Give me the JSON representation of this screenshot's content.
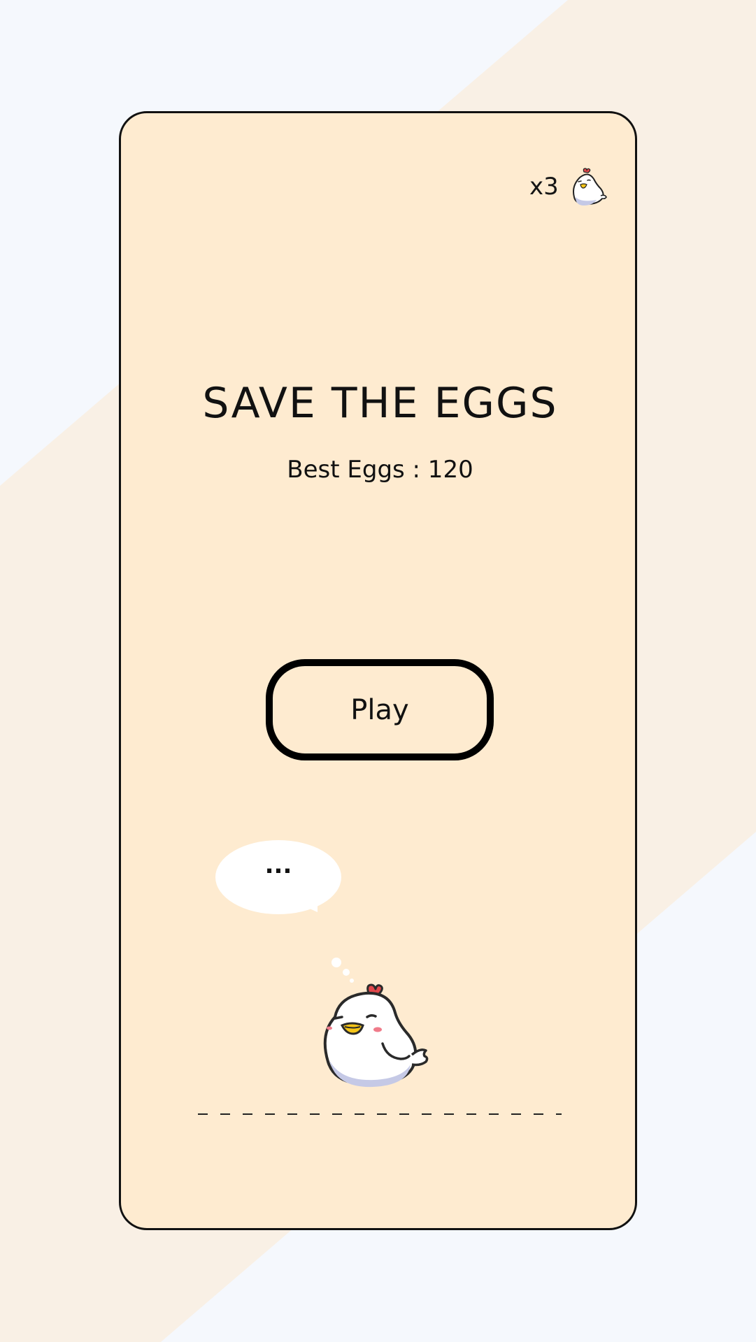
{
  "lives": {
    "count_text": "x3",
    "icon": "chicken-icon"
  },
  "title": "SAVE THE EGGS",
  "best_score": "Best Eggs : 120",
  "play_button": {
    "label": "Play"
  },
  "thought_bubble": {
    "text": "..."
  },
  "colors": {
    "background": "#f5f8fd",
    "background_band": "#f9f0e5",
    "card": "#feebd0",
    "outline": "#111111",
    "comb": "#e2474b",
    "beak": "#f5c518",
    "belly_shade": "#c5c9e6",
    "cheek": "#f07b8a"
  }
}
